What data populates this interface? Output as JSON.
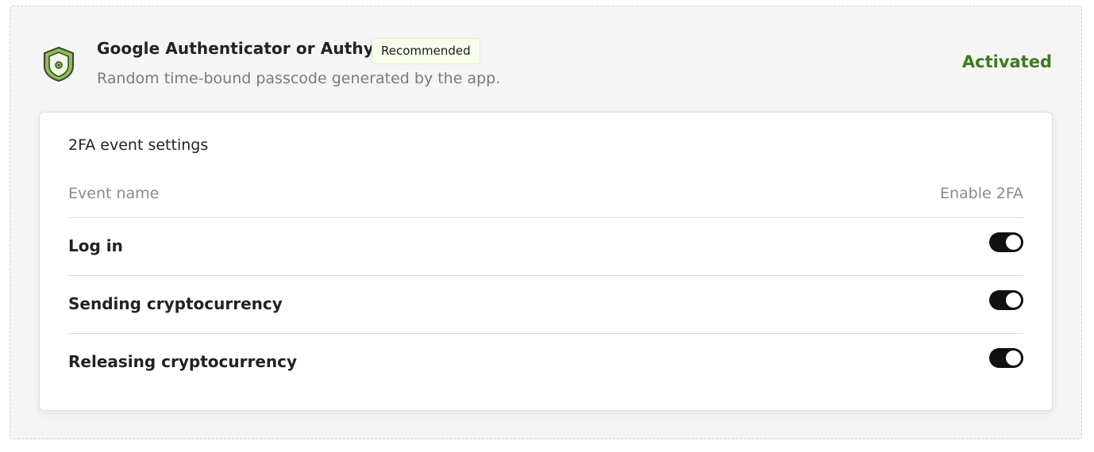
{
  "method": {
    "icon": "shield-icon",
    "title": "Google Authenticator or Authy",
    "badge": "Recommended",
    "description": "Random time-bound passcode generated by the app.",
    "status": "Activated",
    "status_color": "#3e7a1f",
    "accent_color": "#8bc34a"
  },
  "settings": {
    "title": "2FA event settings",
    "columns": {
      "event": "Event name",
      "enable": "Enable 2FA"
    },
    "events": [
      {
        "label": "Log in",
        "enabled": true
      },
      {
        "label": "Sending cryptocurrency",
        "enabled": true
      },
      {
        "label": "Releasing cryptocurrency",
        "enabled": true
      }
    ]
  }
}
